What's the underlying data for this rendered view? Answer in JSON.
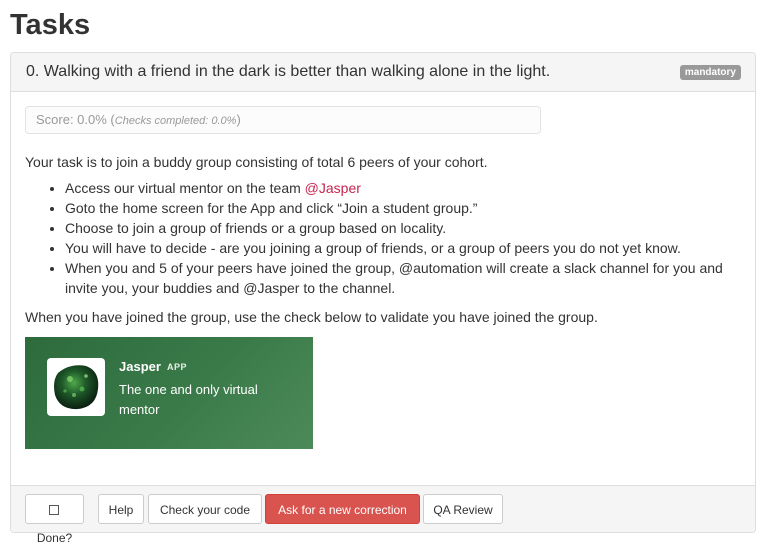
{
  "page": {
    "title": "Tasks"
  },
  "task": {
    "title": "0. Walking with a friend in the dark is better than walking alone in the light.",
    "badge": "mandatory",
    "score_label": "Score: 0.0% (",
    "score_checks": "Checks completed: 0.0%",
    "score_close": ")",
    "intro": "Your task is to join a buddy group consisting of total 6 peers of your cohort.",
    "steps": [
      {
        "text": "Access our virtual mentor on the team ",
        "mention": "@Jasper"
      },
      {
        "text": "Goto the home screen for the App and click “Join a student group.”"
      },
      {
        "text": "Choose to join a group of friends or a group based on locality."
      },
      {
        "text": "You will have to decide - are you joining a group of friends, or a group of peers you do not yet know."
      },
      {
        "text": "When you and 5 of your peers have joined the group, @automation will create a slack channel for you and invite you, your buddies and @Jasper to the channel."
      }
    ],
    "outro": "When you have joined the group, use the check below to validate you have joined the group."
  },
  "card": {
    "name": "Jasper",
    "tag": "APP",
    "description": "The one and only virtual mentor",
    "avatar_icon": "green-gem-avatar-icon",
    "bg_color": "#2d6b3c"
  },
  "footer": {
    "done_label": "Done?",
    "help_label": "Help",
    "check_label": "Check your code",
    "correction_label": "Ask for a new correction",
    "qa_label": "QA Review"
  },
  "colors": {
    "danger": "#d9534f",
    "mention": "#c7254e",
    "badge": "#999999"
  }
}
